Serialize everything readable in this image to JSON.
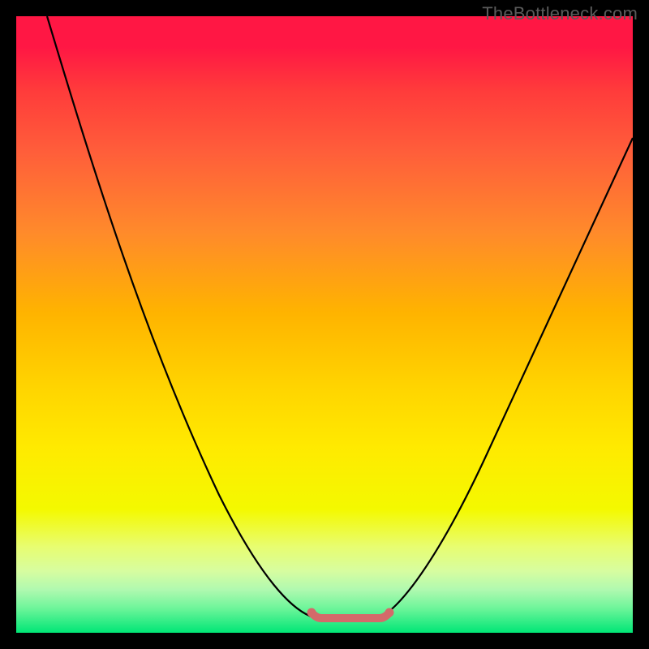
{
  "watermark": "TheBottleneck.com",
  "chart_data": {
    "type": "line",
    "title": "",
    "xlabel": "",
    "ylabel": "",
    "x": [
      0.0,
      0.05,
      0.1,
      0.15,
      0.2,
      0.25,
      0.3,
      0.35,
      0.4,
      0.45,
      0.48,
      0.5,
      0.52,
      0.55,
      0.58,
      0.6,
      0.65,
      0.7,
      0.75,
      0.8,
      0.85,
      0.9,
      0.95,
      1.0
    ],
    "y": [
      1.0,
      0.9,
      0.78,
      0.66,
      0.54,
      0.42,
      0.31,
      0.21,
      0.13,
      0.06,
      0.03,
      0.02,
      0.02,
      0.02,
      0.02,
      0.03,
      0.06,
      0.12,
      0.2,
      0.3,
      0.41,
      0.53,
      0.65,
      0.77
    ],
    "xlim": [
      0,
      1
    ],
    "ylim": [
      0,
      1
    ],
    "accent_segment": {
      "x_start": 0.48,
      "x_end": 0.6,
      "color": "#d86a6a"
    },
    "background_gradient": {
      "top": "#ff1744",
      "mid": "#ffd400",
      "bottom": "#00e676"
    }
  }
}
